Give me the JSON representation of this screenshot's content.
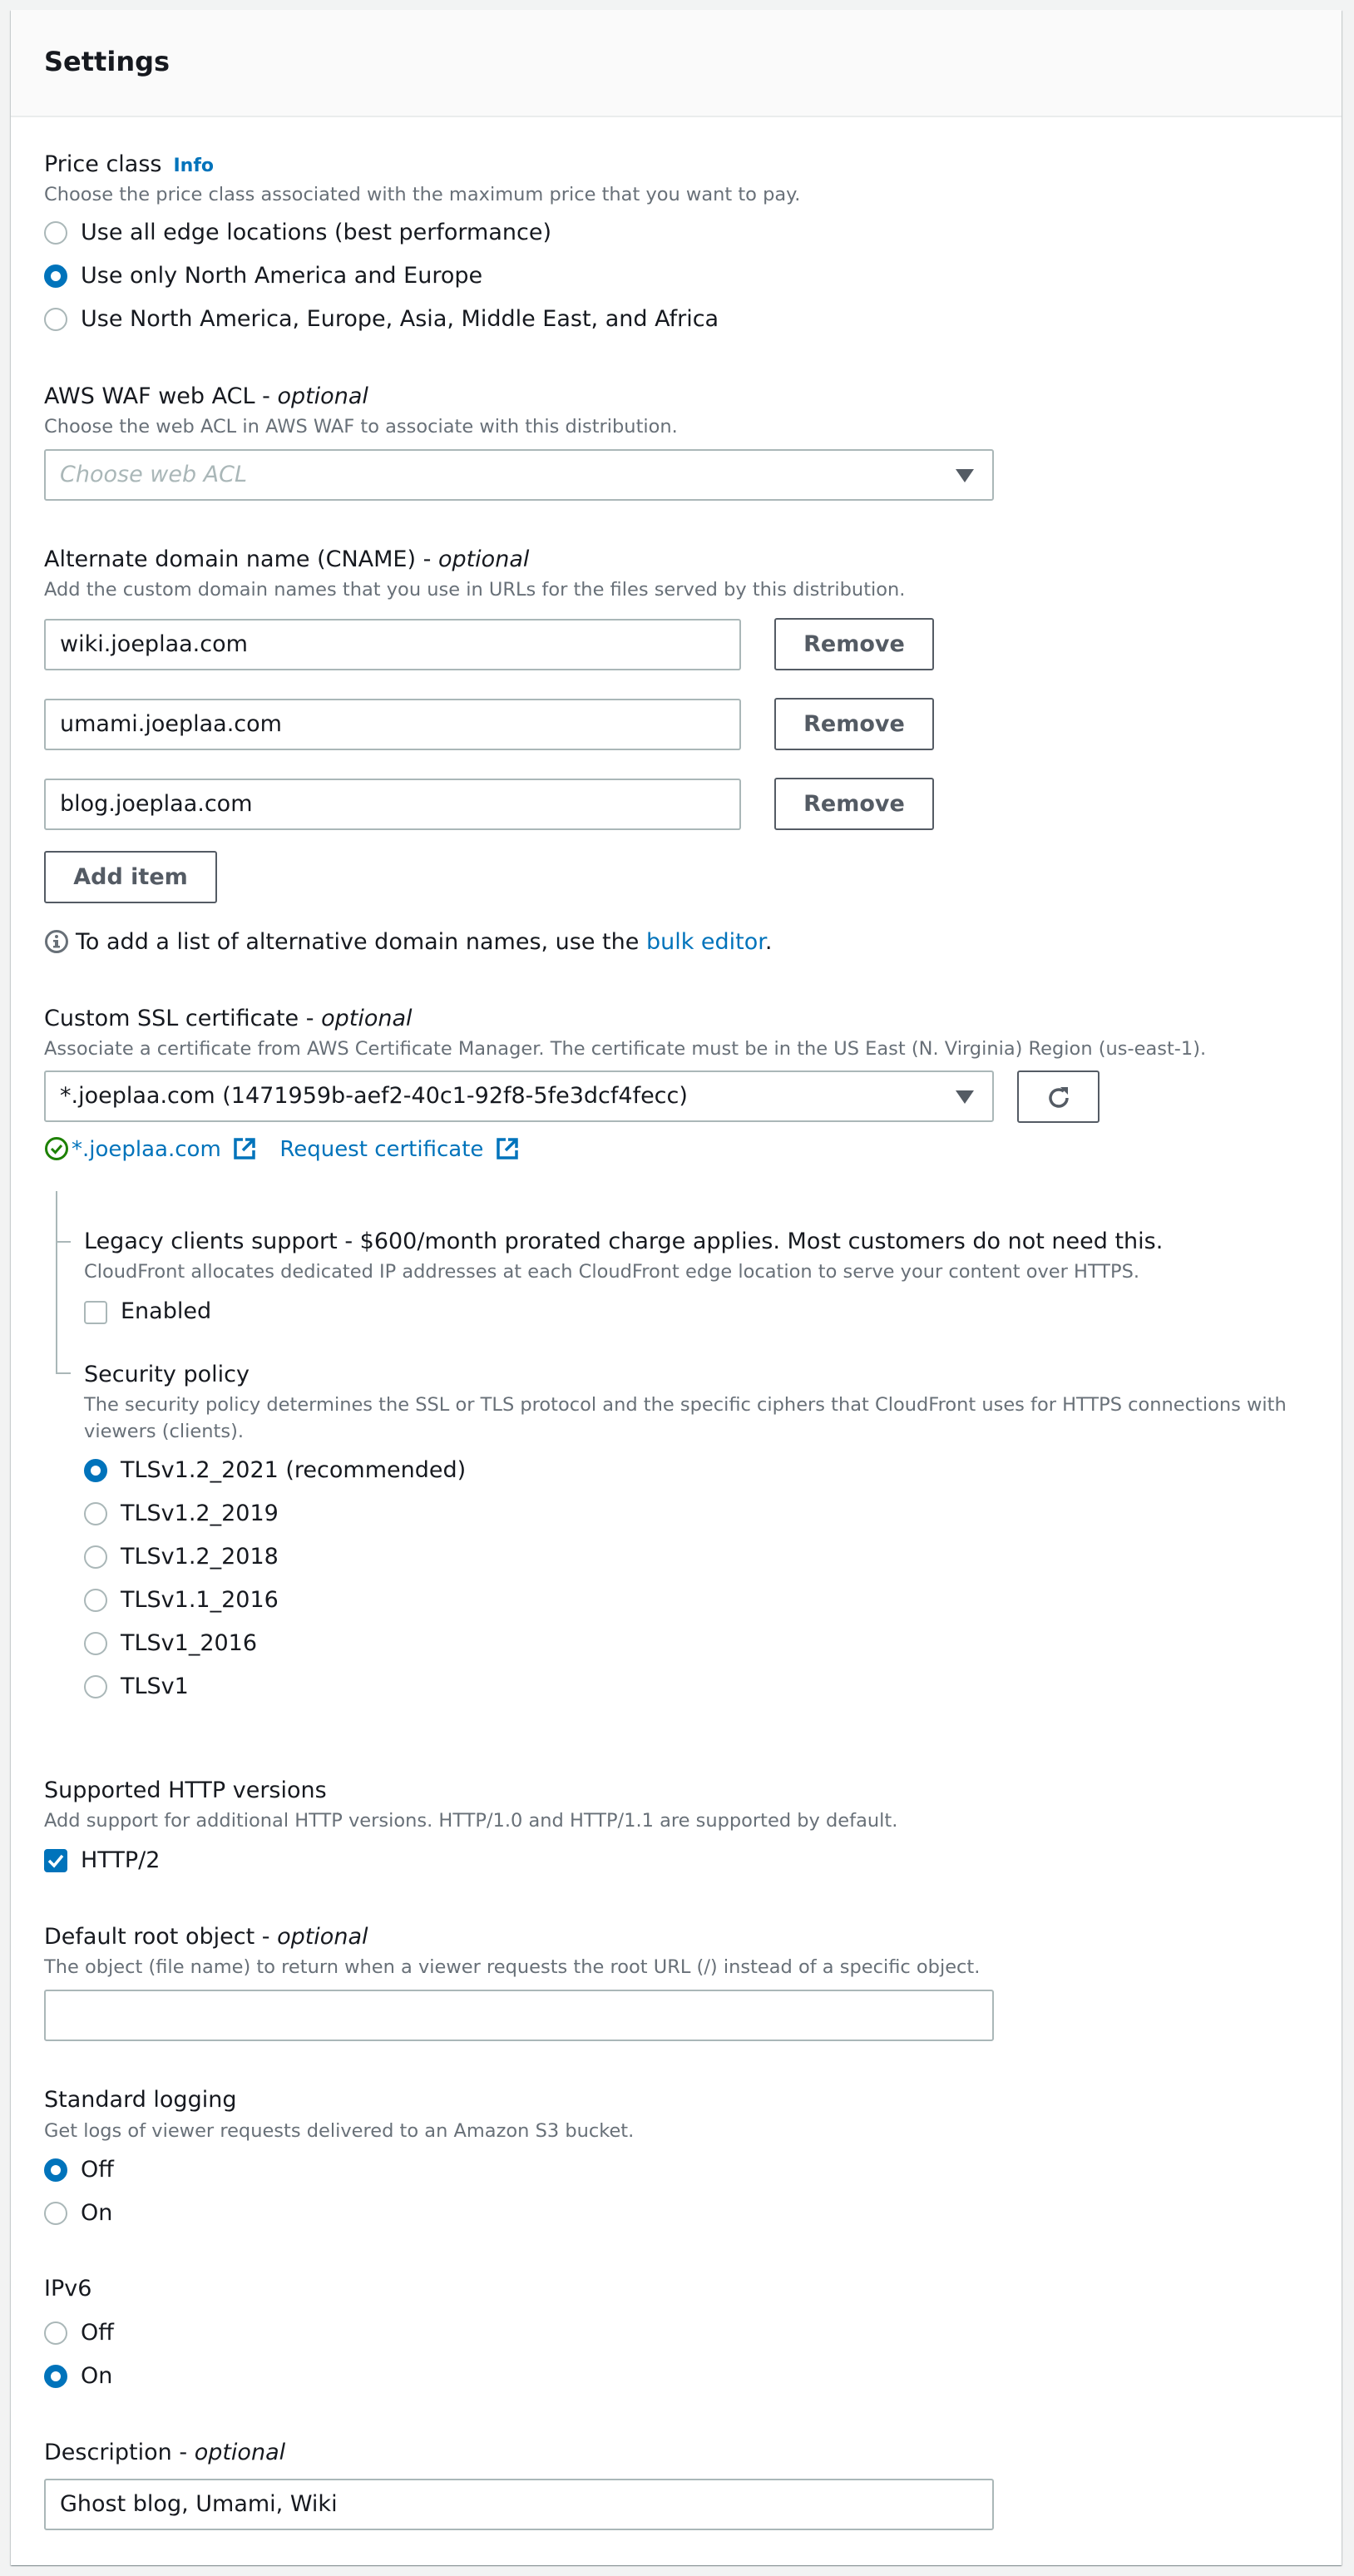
{
  "panel": {
    "title": "Settings"
  },
  "price_class": {
    "label": "Price class",
    "info_link": "Info",
    "description": "Choose the price class associated with the maximum price that you want to pay.",
    "options": [
      {
        "label": "Use all edge locations (best performance)",
        "selected": false
      },
      {
        "label": "Use only North America and Europe",
        "selected": true
      },
      {
        "label": "Use North America, Europe, Asia, Middle East, and Africa",
        "selected": false
      }
    ]
  },
  "waf": {
    "label": "AWS WAF web ACL - ",
    "optional": "optional",
    "description": "Choose the web ACL in AWS WAF to associate with this distribution.",
    "placeholder": "Choose web ACL",
    "value": ""
  },
  "cname": {
    "label": "Alternate domain name (CNAME) - ",
    "optional": "optional",
    "description": "Add the custom domain names that you use in URLs for the files served by this distribution.",
    "items": [
      {
        "value": "wiki.joeplaa.com",
        "remove_label": "Remove"
      },
      {
        "value": "umami.joeplaa.com",
        "remove_label": "Remove"
      },
      {
        "value": "blog.joeplaa.com",
        "remove_label": "Remove"
      }
    ],
    "add_item_label": "Add item",
    "hint_prefix": "To add a list of alternative domain names, use the ",
    "hint_link": "bulk editor",
    "hint_suffix": "."
  },
  "ssl": {
    "label": "Custom SSL certificate - ",
    "optional": "optional",
    "description": "Associate a certificate from AWS Certificate Manager. The certificate must be in the US East (N. Virginia) Region (us-east-1).",
    "selected": "*.joeplaa.com (1471959b-aef2-40c1-92f8-5fe3dcf4fecc)",
    "status_link": "*.joeplaa.com",
    "request_link": "Request certificate",
    "status_color": "#1d8102"
  },
  "legacy": {
    "label": "Legacy clients support - $600/month prorated charge applies. Most customers do not need this.",
    "description": "CloudFront allocates dedicated IP addresses at each CloudFront edge location to serve your content over HTTPS.",
    "checkbox_label": "Enabled",
    "checked": false
  },
  "security_policy": {
    "label": "Security policy",
    "description_line1": "The security policy determines the SSL or TLS protocol and the specific ciphers that CloudFront uses for HTTPS connections with",
    "description_line2": "viewers (clients).",
    "options": [
      {
        "label": "TLSv1.2_2021 (recommended)",
        "selected": true
      },
      {
        "label": "TLSv1.2_2019",
        "selected": false
      },
      {
        "label": "TLSv1.2_2018",
        "selected": false
      },
      {
        "label": "TLSv1.1_2016",
        "selected": false
      },
      {
        "label": "TLSv1_2016",
        "selected": false
      },
      {
        "label": "TLSv1",
        "selected": false
      }
    ]
  },
  "http_versions": {
    "label": "Supported HTTP versions",
    "description": "Add support for additional HTTP versions. HTTP/1.0 and HTTP/1.1 are supported by default.",
    "checkbox_label": "HTTP/2",
    "checked": true
  },
  "root_object": {
    "label": "Default root object - ",
    "optional": "optional",
    "description": "The object (file name) to return when a viewer requests the root URL (/) instead of a specific object.",
    "value": ""
  },
  "logging": {
    "label": "Standard logging",
    "description": "Get logs of viewer requests delivered to an Amazon S3 bucket.",
    "options": [
      {
        "label": "Off",
        "selected": true
      },
      {
        "label": "On",
        "selected": false
      }
    ]
  },
  "ipv6": {
    "label": "IPv6",
    "options": [
      {
        "label": "Off",
        "selected": false
      },
      {
        "label": "On",
        "selected": true
      }
    ]
  },
  "description": {
    "label": "Description - ",
    "optional": "optional",
    "value": "Ghost blog, Umami, Wiki"
  },
  "colors": {
    "accent": "#0073bb",
    "border": "#aab7b8",
    "text": "#16191f",
    "muted": "#687078",
    "button": "#545b64",
    "success": "#1d8102"
  }
}
